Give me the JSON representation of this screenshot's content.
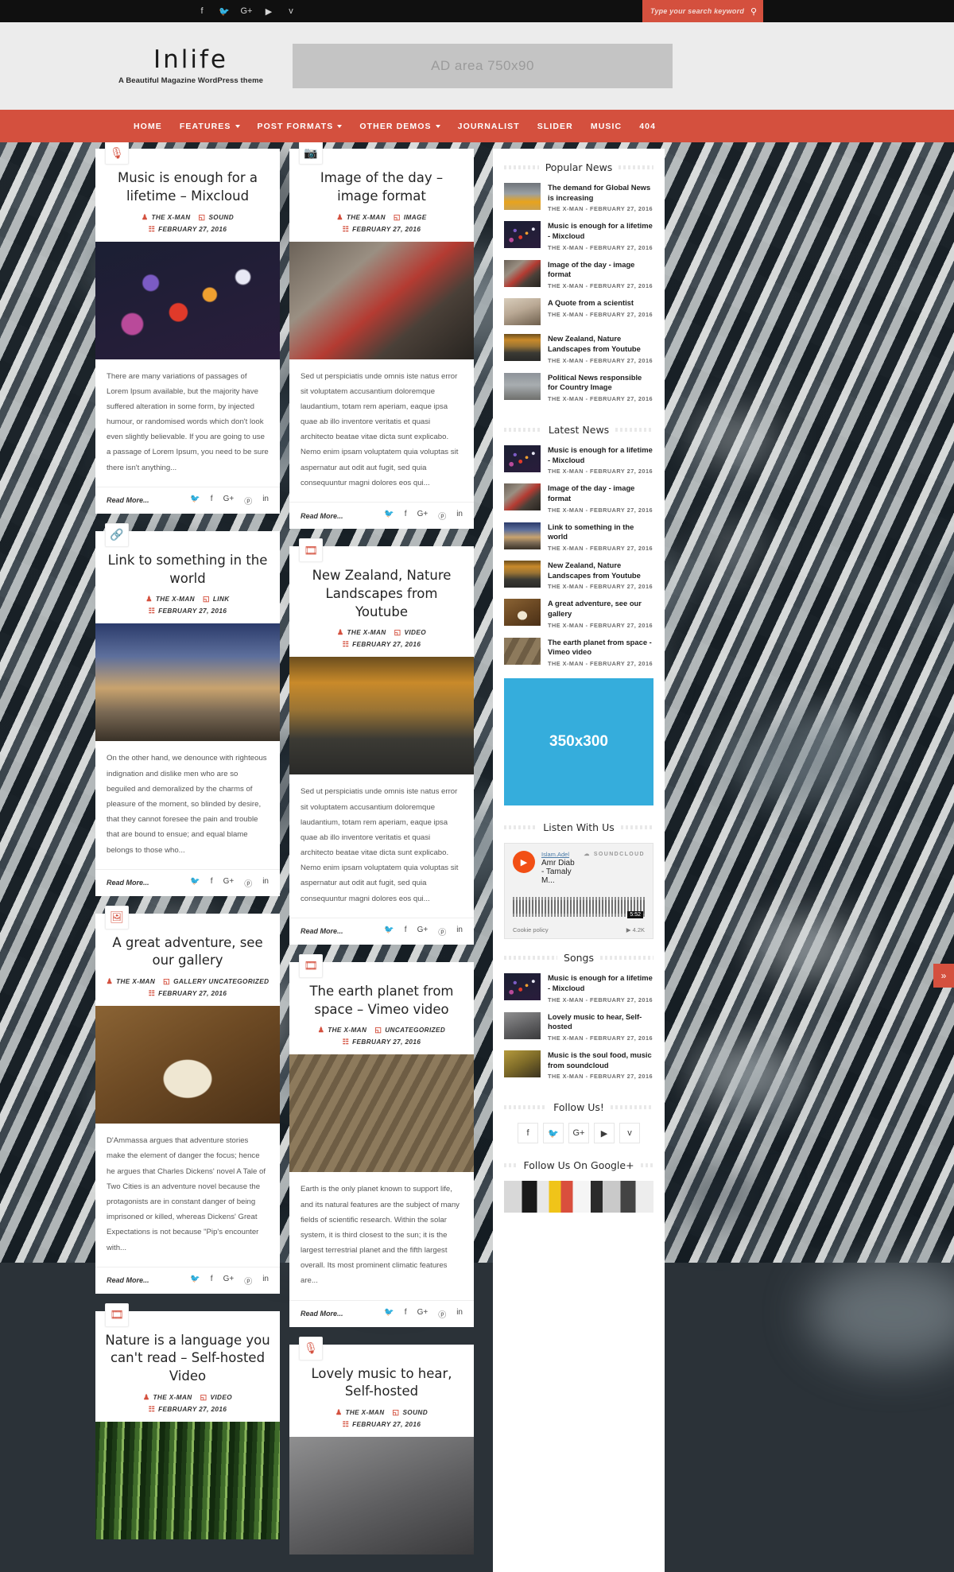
{
  "topbar": {
    "social": [
      {
        "name": "facebook-icon",
        "glyph": "f"
      },
      {
        "name": "twitter-icon",
        "glyph": "🐦"
      },
      {
        "name": "google-plus-icon",
        "glyph": "G+"
      },
      {
        "name": "youtube-icon",
        "glyph": "▶"
      },
      {
        "name": "vimeo-icon",
        "glyph": "v"
      }
    ],
    "search": {
      "placeholder": "Type your search keyword",
      "value": "",
      "icon": "search-icon"
    }
  },
  "header": {
    "logo": "Inlife",
    "tagline": "A Beautiful Magazine WordPress theme",
    "ad": "AD area 750x90"
  },
  "nav": {
    "items": [
      {
        "label": "HOME",
        "caret": false
      },
      {
        "label": "FEATURES",
        "caret": true
      },
      {
        "label": "POST FORMATS",
        "caret": true
      },
      {
        "label": "OTHER DEMOS",
        "caret": true
      },
      {
        "label": "JOURNALIST",
        "caret": false
      },
      {
        "label": "SLIDER",
        "caret": false
      },
      {
        "label": "MUSIC",
        "caret": false
      },
      {
        "label": "404",
        "caret": false
      }
    ]
  },
  "share_icons": [
    "🐦",
    "f",
    "G+",
    "ⓟ",
    "in"
  ],
  "read_more": "Read More...",
  "columns": [
    {
      "posts": [
        {
          "format_icon": "microphone-icon",
          "glyph": "🎙",
          "title": "Music is enough for a lifetime – Mixcloud",
          "author": "THE X-MAN",
          "category": "SOUND",
          "date": "FEBRUARY 27, 2016",
          "excerpt": "There are many variations of passages of Lorem Ipsum available, but the majority have suffered alteration in some form, by injected humour, or randomised words which don't look even slightly believable. If you are going to use a passage of Lorem Ipsum, you need to be sure there isn't anything...",
          "thumb": "bokeh-night-lights"
        },
        {
          "format_icon": "link-icon",
          "glyph": "🔗",
          "title": "Link to something in the world",
          "author": "THE X-MAN",
          "category": "LINK",
          "date": "FEBRUARY 27, 2016",
          "excerpt": "On the other hand, we denounce with righteous indignation and dislike men who are so beguiled and demoralized by the charms of pleasure of the moment, so blinded by desire, that they cannot foresee the pain and trouble that are bound to ensue; and equal blame belongs to those who...",
          "thumb": "city-highway-dusk"
        },
        {
          "format_icon": "gallery-icon",
          "glyph": "🖼",
          "title": "A great adventure, see our gallery",
          "author": "THE X-MAN",
          "category": "GALLERY UNCATEGORIZED",
          "date": "FEBRUARY 27, 2016",
          "excerpt": "D'Ammassa argues that adventure stories make the element of danger the focus; hence he argues that Charles Dickens' novel A Tale of Two Cities is an adventure novel because the protagonists are in constant danger of being imprisoned or killed, whereas Dickens' Great Expectations is not because \"Pip's encounter with...",
          "thumb": "desk-map-camera"
        },
        {
          "format_icon": "video-icon",
          "glyph": "🎞",
          "title": "Nature is a language you can't read – Self-hosted Video",
          "author": "THE X-MAN",
          "category": "VIDEO",
          "date": "FEBRUARY 27, 2016",
          "excerpt": "",
          "thumb": "bamboo-forest"
        }
      ]
    },
    {
      "posts": [
        {
          "format_icon": "image-icon",
          "glyph": "📷",
          "title": "Image of the day – image format",
          "author": "THE X-MAN",
          "category": "IMAGE",
          "date": "FEBRUARY 27, 2016",
          "excerpt": "Sed ut perspiciatis unde omnis iste natus error sit voluptatem accusantium doloremque laudantium, totam rem aperiam, eaque ipsa quae ab illo inventore veritatis et quasi architecto beatae vitae dicta sunt explicabo. Nemo enim ipsam voluptatem quia voluptas sit aspernatur aut odit aut fugit, sed quia consequuntur magni dolores eos qui...",
          "thumb": "woman-guitar-shop"
        },
        {
          "format_icon": "video-icon",
          "glyph": "🎞",
          "title": "New Zealand, Nature Landscapes from Youtube",
          "author": "THE X-MAN",
          "category": "VIDEO",
          "date": "FEBRUARY 27, 2016",
          "excerpt": "Sed ut perspiciatis unde omnis iste natus error sit voluptatem accusantium doloremque laudantium, totam rem aperiam, eaque ipsa quae ab illo inventore veritatis et quasi architecto beatae vitae dicta sunt explicabo. Nemo enim ipsam voluptatem quia voluptas sit aspernatur aut odit aut fugit, sed quia consequuntur magni dolores eos qui...",
          "thumb": "car-autumn-road"
        },
        {
          "format_icon": "video-icon",
          "glyph": "🎞",
          "title": "The earth planet from space – Vimeo video",
          "author": "THE X-MAN",
          "category": "UNCATEGORIZED",
          "date": "FEBRUARY 27, 2016",
          "excerpt": "Earth is the only planet known to support life, and its natural features are the subject of many fields of scientific research. Within the solar system, it is third closest to the sun; it is the largest terrestrial planet and the fifth largest overall. Its most prominent climatic features are...",
          "thumb": "aerial-building-plaza"
        },
        {
          "format_icon": "microphone-icon",
          "glyph": "🎙",
          "title": "Lovely music to hear, Self-hosted",
          "author": "THE X-MAN",
          "category": "SOUND",
          "date": "FEBRUARY 27, 2016",
          "excerpt": "",
          "thumb": "white-earphones"
        }
      ]
    }
  ],
  "sidebar": {
    "popular": {
      "title": "Popular News",
      "items": [
        {
          "title": "The demand for Global News is increasing",
          "meta": "THE X-MAN  -  FEBRUARY 27, 2016",
          "thumb": "taxi-street"
        },
        {
          "title": "Music is enough for a lifetime - Mixcloud",
          "meta": "THE X-MAN  -  FEBRUARY 27, 2016",
          "thumb": "bokeh-night-lights"
        },
        {
          "title": "Image of the day - image format",
          "meta": "THE X-MAN  -  FEBRUARY 27, 2016",
          "thumb": "woman-guitar-shop"
        },
        {
          "title": "A Quote from a scientist",
          "meta": "THE X-MAN  -  FEBRUARY 27, 2016",
          "thumb": "desk-papers"
        },
        {
          "title": "New Zealand, Nature Landscapes from Youtube",
          "meta": "THE X-MAN  -  FEBRUARY 27, 2016",
          "thumb": "car-autumn-road"
        },
        {
          "title": "Political News responsible for Country Image",
          "meta": "THE X-MAN  -  FEBRUARY 27, 2016",
          "thumb": "city-street"
        }
      ]
    },
    "latest": {
      "title": "Latest News",
      "items": [
        {
          "title": "Music is enough for a lifetime - Mixcloud",
          "meta": "THE X-MAN  -  FEBRUARY 27, 2016",
          "thumb": "bokeh-night-lights"
        },
        {
          "title": "Image of the day - image format",
          "meta": "THE X-MAN  -  FEBRUARY 27, 2016",
          "thumb": "woman-guitar-shop"
        },
        {
          "title": "Link to something in the world",
          "meta": "THE X-MAN  -  FEBRUARY 27, 2016",
          "thumb": "city-highway-dusk"
        },
        {
          "title": "New Zealand, Nature Landscapes from Youtube",
          "meta": "THE X-MAN  -  FEBRUARY 27, 2016",
          "thumb": "car-autumn-road"
        },
        {
          "title": "A great adventure, see our gallery",
          "meta": "THE X-MAN  -  FEBRUARY 27, 2016",
          "thumb": "desk-map-camera"
        },
        {
          "title": "The earth planet from space - Vimeo video",
          "meta": "THE X-MAN  -  FEBRUARY 27, 2016",
          "thumb": "aerial-building-plaza"
        }
      ]
    },
    "ad": "350x300",
    "listen": {
      "title": "Listen With Us",
      "user": "Islam.Adel",
      "track": "Amr Diab - Tamaly M...",
      "brand": "SOUNDCLOUD",
      "duration": "5:52",
      "plays": "4.2K",
      "cookie": "Cookie policy"
    },
    "songs": {
      "title": "Songs",
      "items": [
        {
          "title": "Music is enough for a lifetime - Mixcloud",
          "meta": "THE X-MAN  -  FEBRUARY 27, 2016",
          "thumb": "bokeh-night-lights"
        },
        {
          "title": "Lovely music to hear, Self-hosted",
          "meta": "THE X-MAN  -  FEBRUARY 27, 2016",
          "thumb": "white-earphones"
        },
        {
          "title": "Music is the soul food, music from soundcloud",
          "meta": "THE X-MAN  -  FEBRUARY 27, 2016",
          "thumb": "brass-instrument"
        }
      ]
    },
    "follow": {
      "title": "Follow Us!",
      "icons": [
        {
          "name": "facebook-icon",
          "glyph": "f"
        },
        {
          "name": "twitter-icon",
          "glyph": "🐦"
        },
        {
          "name": "google-plus-icon",
          "glyph": "G+"
        },
        {
          "name": "youtube-icon",
          "glyph": "▶"
        },
        {
          "name": "vimeo-icon",
          "glyph": "v"
        }
      ]
    },
    "gplus": {
      "title": "Follow Us On Google+"
    }
  },
  "back_to_top": "»"
}
